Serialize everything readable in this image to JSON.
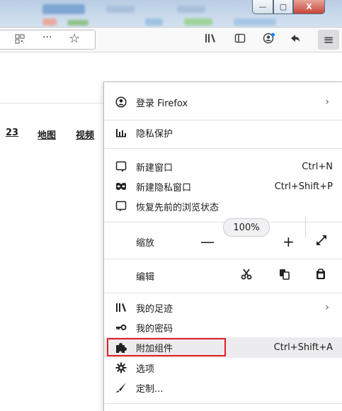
{
  "menu": {
    "login_label": "登录 Firefox",
    "privacy_label": "隐私保护",
    "new_window_label": "新建窗口",
    "new_window_shortcut": "Ctrl+N",
    "new_private_label": "新建隐私窗口",
    "new_private_shortcut": "Ctrl+Shift+P",
    "restore_label": "恢复先前的浏览状态",
    "zoom_label": "缩放",
    "zoom_minus": "—",
    "zoom_value": "100%",
    "zoom_plus": "+",
    "edit_label": "编辑",
    "library_label": "我的足迹",
    "logins_label": "我的密码",
    "addons_label": "附加组件",
    "addons_shortcut": "Ctrl+Shift+A",
    "options_label": "选项",
    "customize_label": "定制..."
  },
  "page": {
    "nav_partial": "23",
    "nav_map": "地图",
    "nav_video": "视频"
  },
  "toolbar": {
    "menu_glyph": "≡",
    "more_glyph": "···",
    "star_glyph": "☆"
  },
  "window": {
    "minimize_glyph": "—",
    "maximize_glyph": "▢",
    "close_glyph": "X"
  },
  "colors": {
    "highlight_border": "#e31c23",
    "panel_hover": "#ececee"
  },
  "icons": [
    "qr-code-icon",
    "more-icon",
    "star-icon",
    "library-icon",
    "sidebar-icon",
    "account-icon",
    "back-arrow-icon",
    "hamburger-menu-icon",
    "user-circle-icon",
    "privacy-chart-icon",
    "new-window-icon",
    "private-mask-icon",
    "restore-session-icon",
    "fullscreen-icon",
    "cut-icon",
    "copy-icon",
    "paste-icon",
    "library-books-icon",
    "key-icon",
    "puzzle-icon",
    "gear-icon",
    "pen-icon"
  ]
}
